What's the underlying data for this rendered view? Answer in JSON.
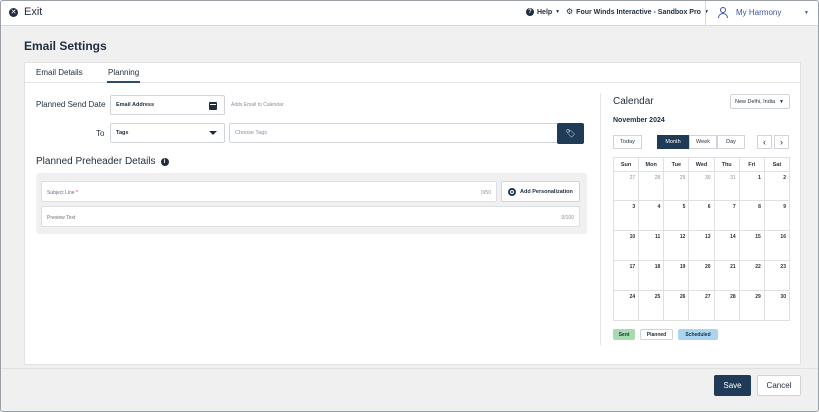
{
  "topbar": {
    "exit_label": "Exit",
    "help_label": "Help",
    "org_label": "Four Winds Interactive - Sandbox Pro",
    "user_label": "My Harmony"
  },
  "page": {
    "title": "Email Settings"
  },
  "tabs": [
    {
      "label": "Email Details",
      "active": false
    },
    {
      "label": "Planning",
      "active": true
    }
  ],
  "form": {
    "send_date_label": "Planned Send Date",
    "email_field_value": "Email Address",
    "email_hint": "Adds Email to Calendar",
    "to_label": "To",
    "tags_value": "Tags",
    "choose_tags_placeholder": "Choose Tags"
  },
  "preheader": {
    "title": "Planned Preheader Details",
    "subject_placeholder": "Subject Line",
    "subject_required": "*",
    "subject_count": "0/50",
    "personalization_label": "Add Personalization",
    "preview_placeholder": "Preview Text",
    "preview_count": "0/100"
  },
  "calendar": {
    "title": "Calendar",
    "timezone": "New Delhi, India",
    "month_title": "November 2024",
    "today_label": "Today",
    "month_label": "Month",
    "week_label": "Week",
    "day_label": "Day",
    "prev_arrow": "‹",
    "next_arrow": "›",
    "weekdays": [
      "Sun",
      "Mon",
      "Tue",
      "Wed",
      "Thu",
      "Fri",
      "Sat"
    ],
    "weeks": [
      [
        "27",
        "28",
        "29",
        "30",
        "31",
        "1",
        "2"
      ],
      [
        "3",
        "4",
        "5",
        "6",
        "7",
        "8",
        "9"
      ],
      [
        "10",
        "11",
        "12",
        "13",
        "14",
        "15",
        "16"
      ],
      [
        "17",
        "18",
        "19",
        "20",
        "21",
        "22",
        "23"
      ],
      [
        "24",
        "25",
        "26",
        "27",
        "28",
        "29",
        "30"
      ]
    ],
    "muted_cells": [
      "0-0",
      "0-1",
      "0-2",
      "0-3",
      "0-4"
    ],
    "legend": {
      "sent": "Sent",
      "planned": "Planned",
      "scheduled": "Scheduled"
    }
  },
  "footer": {
    "save_label": "Save",
    "cancel_label": "Cancel"
  },
  "colors": {
    "primary": "#1f3b57",
    "link": "#3d52a8",
    "sent": "#a6dcae",
    "scheduled": "#aad4f0"
  }
}
